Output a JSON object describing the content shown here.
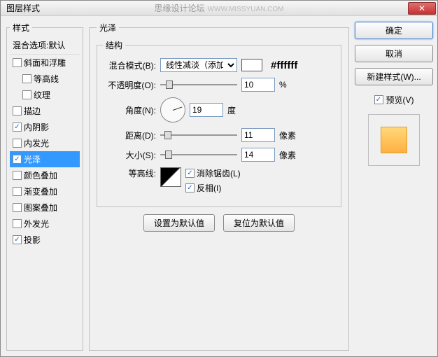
{
  "window": {
    "title": "图层样式",
    "watermark": "思缘设计论坛",
    "url": "WWW.MISSYUAN.COM"
  },
  "styles": {
    "legend": "样式",
    "blend_header": "混合选项:默认",
    "items": [
      {
        "label": "斜面和浮雕",
        "checked": false,
        "indent": false
      },
      {
        "label": "等高线",
        "checked": false,
        "indent": true
      },
      {
        "label": "纹理",
        "checked": false,
        "indent": true
      },
      {
        "label": "描边",
        "checked": false,
        "indent": false
      },
      {
        "label": "内阴影",
        "checked": true,
        "indent": false
      },
      {
        "label": "内发光",
        "checked": false,
        "indent": false
      },
      {
        "label": "光泽",
        "checked": true,
        "indent": false,
        "selected": true
      },
      {
        "label": "颜色叠加",
        "checked": false,
        "indent": false
      },
      {
        "label": "渐变叠加",
        "checked": false,
        "indent": false
      },
      {
        "label": "图案叠加",
        "checked": false,
        "indent": false
      },
      {
        "label": "外发光",
        "checked": false,
        "indent": false
      },
      {
        "label": "投影",
        "checked": true,
        "indent": false
      }
    ]
  },
  "satin": {
    "legend": "光泽",
    "struct_legend": "结构",
    "blend_mode": {
      "label": "混合模式(B):",
      "value": "线性减淡（添加）",
      "hex": "#ffffff"
    },
    "opacity": {
      "label": "不透明度(O):",
      "value": "10",
      "unit": "%"
    },
    "angle": {
      "label": "角度(N):",
      "value": "19",
      "unit": "度"
    },
    "distance": {
      "label": "距离(D):",
      "value": "11",
      "unit": "像素"
    },
    "size": {
      "label": "大小(S):",
      "value": "14",
      "unit": "像素"
    },
    "contour": {
      "label": "等高线:",
      "antialias": "消除锯齿(L)",
      "invert": "反相(I)"
    },
    "reset_btn": "设置为默认值",
    "restore_btn": "复位为默认值"
  },
  "buttons": {
    "ok": "确定",
    "cancel": "取消",
    "new_style": "新建样式(W)...",
    "preview": "预览(V)"
  }
}
